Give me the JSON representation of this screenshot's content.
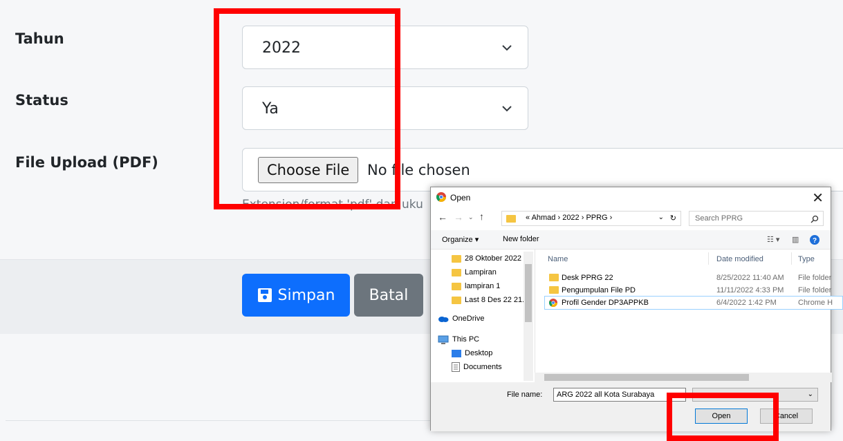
{
  "form": {
    "tahun": {
      "label": "Tahun",
      "value": "2022"
    },
    "status": {
      "label": "Status",
      "value": "Ya"
    },
    "file_upload": {
      "label": "File Upload (PDF)",
      "button_label": "Choose File",
      "status_text": "No file chosen",
      "help_text": "Extension/format 'pdf' dan uku"
    }
  },
  "actions": {
    "save_label": "Simpan",
    "cancel_label": "Batal"
  },
  "dialog": {
    "title": "Open",
    "address": "«  Ahmad  ›  2022  ›  PPRG  ›",
    "search_placeholder": "Search PPRG",
    "toolbar": {
      "organize": "Organize ▾",
      "new_folder": "New folder"
    },
    "nav_items": [
      "28 Oktober 2022",
      "Lampiran",
      "lampiran 1",
      "Last 8 Des 22 21.",
      "OneDrive",
      "This PC",
      "Desktop",
      "Documents"
    ],
    "columns": {
      "name": "Name",
      "date": "Date modified",
      "type": "Type"
    },
    "files": [
      {
        "name": "Desk PPRG 22",
        "date": "8/25/2022 11:40 AM",
        "type": "File folder"
      },
      {
        "name": "Pengumpulan File PD",
        "date": "11/11/2022 4:33 PM",
        "type": "File folder"
      },
      {
        "name": "Profil Gender DP3APPKB",
        "date": "6/4/2022 1:42 PM",
        "type": "Chrome H"
      }
    ],
    "file_name_label": "File name:",
    "file_name_value": "ARG 2022 all Kota Surabaya",
    "open_label": "Open",
    "cancel_label": "Cancel"
  },
  "colors": {
    "primary": "#0d6efd",
    "secondary": "#6c757d",
    "highlight": "#ff0000"
  }
}
